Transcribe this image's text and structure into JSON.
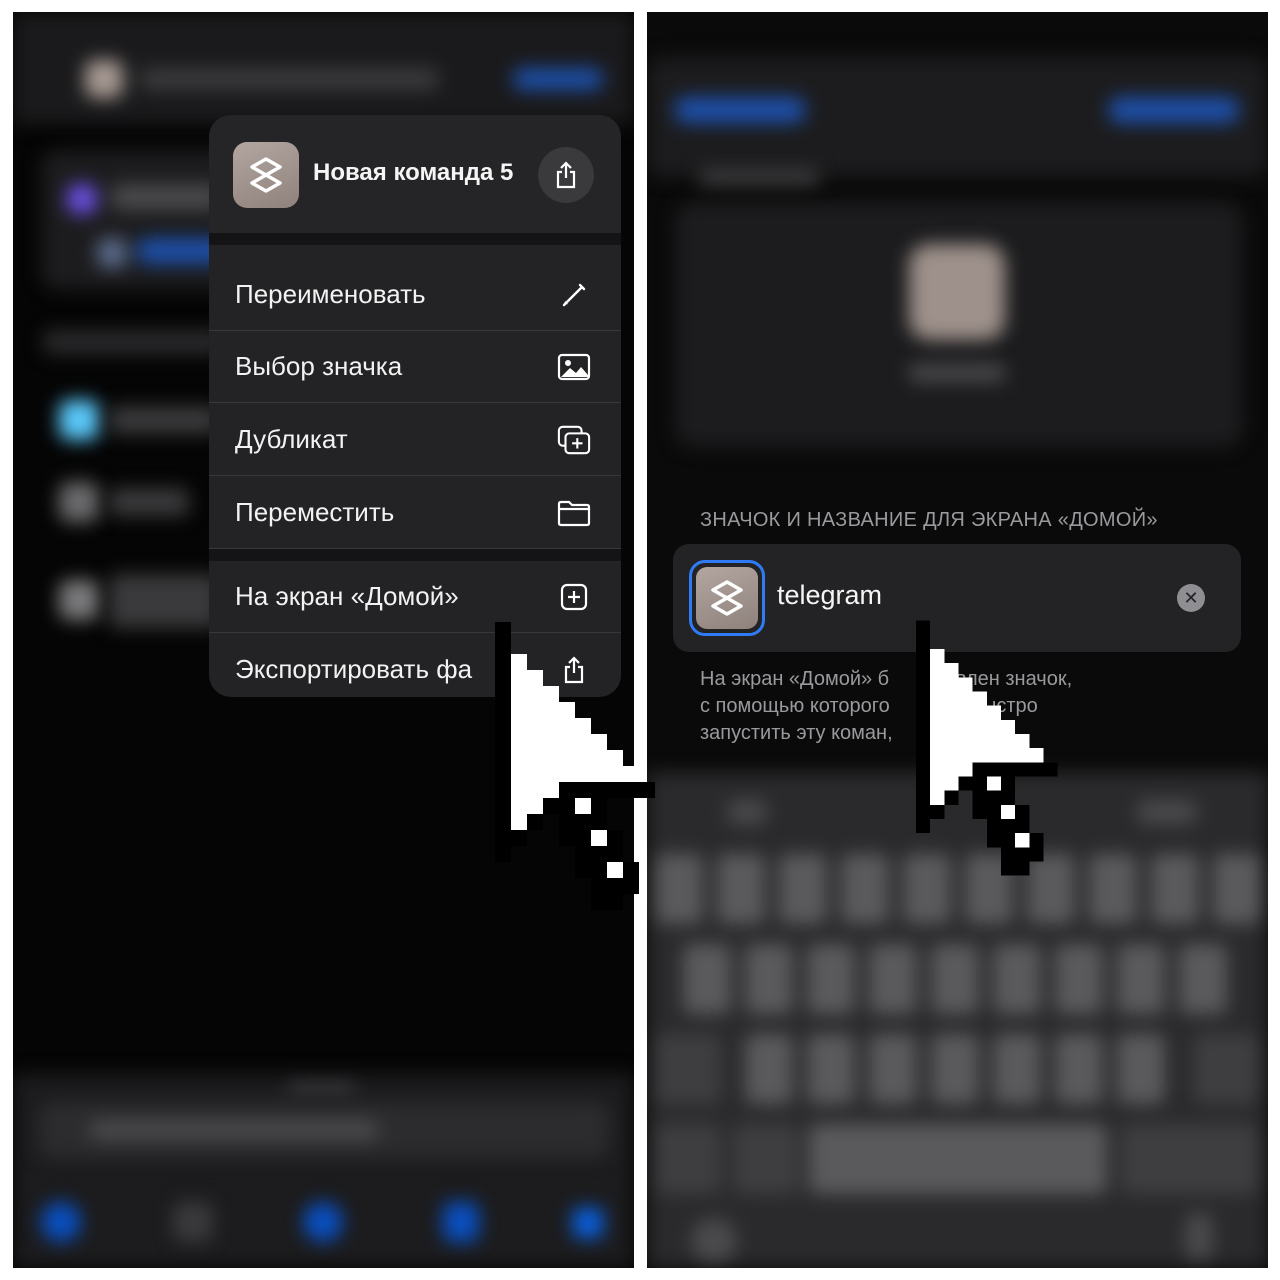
{
  "menu": {
    "title": "Новая команда 5",
    "items": [
      {
        "label": "Переименовать",
        "icon": "pencil-icon"
      },
      {
        "label": "Выбор значка",
        "icon": "image-icon"
      },
      {
        "label": "Дубликат",
        "icon": "duplicate-icon"
      },
      {
        "label": "Переместить",
        "icon": "folder-icon"
      },
      {
        "label": "На экран «Домой»",
        "icon": "add-square-icon"
      },
      {
        "label": "Экспортировать фа",
        "icon": "share-icon"
      }
    ]
  },
  "home_screen": {
    "section_label": "ЗНАЧОК И НАЗВАНИЕ ДЛЯ ЭКРАНА «ДОМОЙ»",
    "name_value": "telegram",
    "note_lines": [
      "На экран «Домой» б          авлен значок,",
      "с помощью которого          ет быстро",
      "запустить эту коман,"
    ]
  },
  "colors": {
    "accent": "#2f7bf6",
    "menu_bg": "#232325",
    "icon_bg": "#a0938d"
  }
}
